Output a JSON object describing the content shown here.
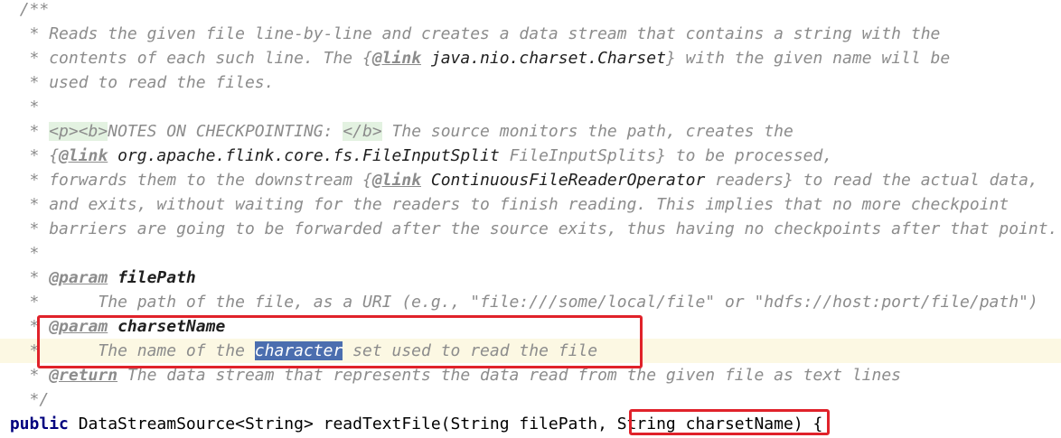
{
  "code": {
    "l1": "/**",
    "l2": "Reads the given file line-by-line and creates a data stream that contains a string with the",
    "l3a": "contents of each such line. The {",
    "link": "@link",
    "l3ref": "java.nio.charset.Charset",
    "l3b": "} with the given name will be",
    "l4": "used to read the files.",
    "tag1": "<p><b>",
    "notes": "NOTES ON CHECKPOINTING: ",
    "tag2": "</b>",
    "l6b": " The source monitors the path, creates the",
    "l7a": "{",
    "l7ref": "org.apache.flink.core.fs.FileInputSplit",
    "l7ref2": "FileInputSplits",
    "l7b": "} to be processed,",
    "l8a": "forwards them to the downstream {",
    "l8ref": "ContinuousFileReaderOperator",
    "l8b": " readers} to read the actual data,",
    "l9": "and exits, without waiting for the readers to finish reading. This implies that no more checkpoint",
    "l10": "barriers are going to be forwarded after the source exits, thus having no checkpoints after that point.",
    "param_kw": "@param",
    "p1_name": "filePath",
    "p1_desc": "The path of the file, as a URI (e.g., \"file:///some/local/file\" or \"hdfs://host:port/file/path\")",
    "p2_name": "charsetName",
    "p2_desc_a": "The name of the ",
    "p2_sel": "character",
    "p2_desc_b": " set used to read the file",
    "return_kw": "@return",
    "return_desc": "The data stream that represents the data read from the given file as text lines",
    "close": "*/",
    "public_kw": "public",
    "sig_a": " DataStreamSource<String> readTextFile(String filePath, ",
    "sig_param": "String charsetName)",
    "sig_b": " {"
  },
  "colors": {
    "highlight_box": "#e0222a",
    "selection": "#4b6eaf",
    "caret_line": "#fcf8e3"
  }
}
